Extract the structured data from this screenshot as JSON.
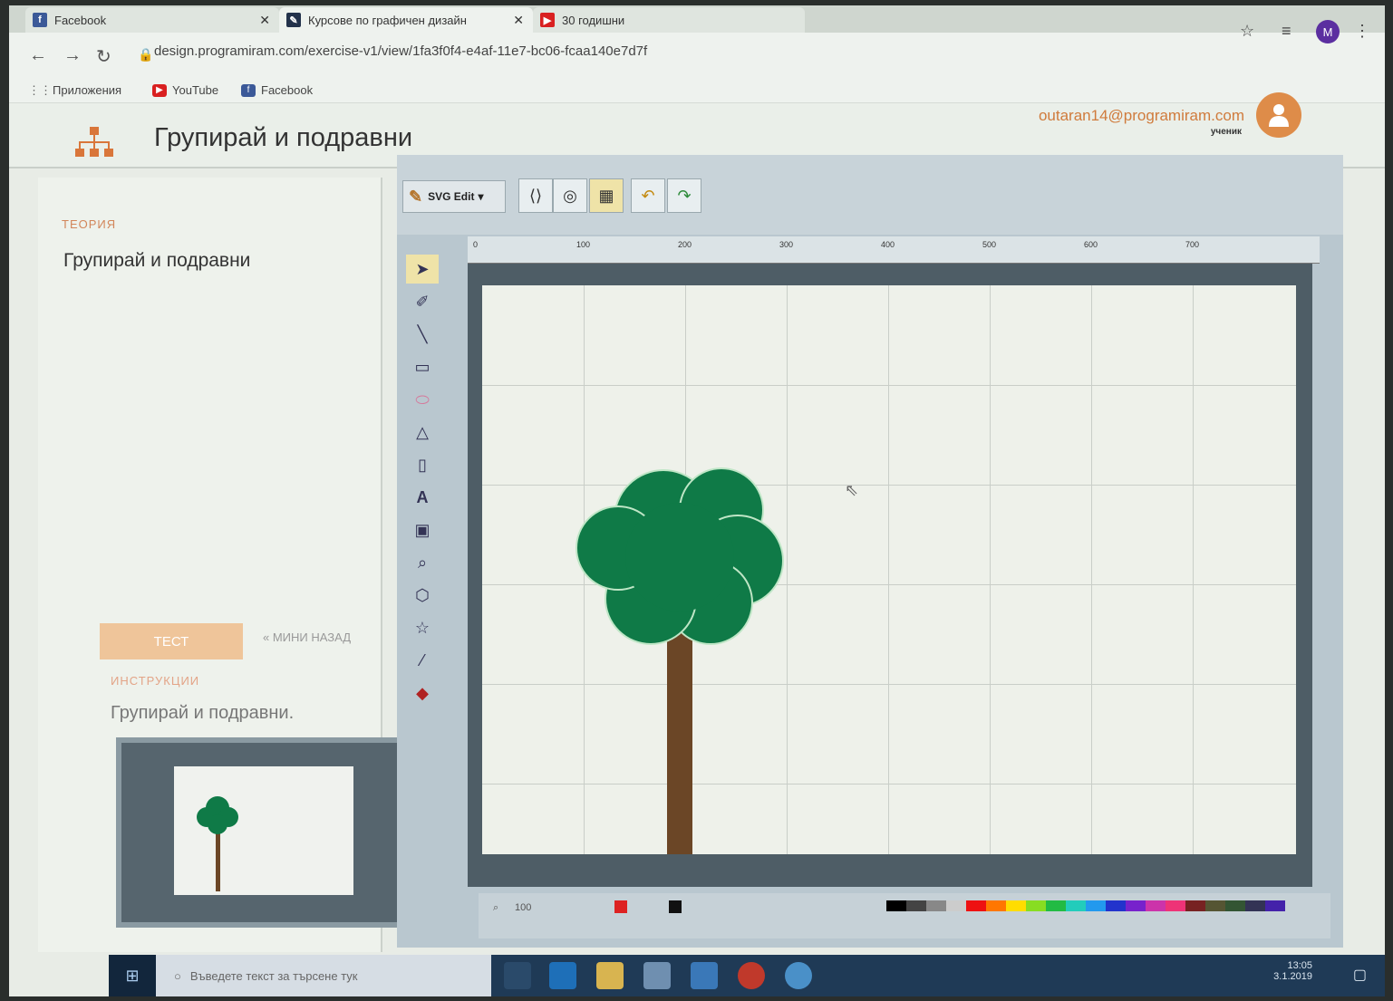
{
  "browser": {
    "tabs": [
      {
        "label": "Facebook",
        "favicon": "facebook-icon"
      },
      {
        "label": "Курсове по графичен дизайн",
        "favicon": "programiram-icon"
      },
      {
        "label": "30 годишни",
        "favicon": "youtube-icon"
      }
    ],
    "url": "design.programiram.com/exercise-v1/view/1fa3f0f4-e4af-11e7-bc06-fcaa140e7d7f",
    "profile_initial": "M",
    "bookmarks": [
      {
        "label": "Приложения",
        "icon": "apps-icon"
      },
      {
        "label": "YouTube",
        "icon": "youtube-icon"
      },
      {
        "label": "Facebook",
        "icon": "facebook-icon"
      }
    ]
  },
  "header": {
    "title": "Групирай и подравни",
    "user_email": "outaran14@programiram.com",
    "user_role": "ученик",
    "accent": "#d07b3c"
  },
  "left_panel": {
    "theory_label": "ТЕОРИЯ",
    "theory_title": "Групирай и подравни",
    "test_button": "ТЕСТ",
    "back_link": "« МИНИ НАЗАД",
    "instructions_label": "ИНСТРУКЦИИ",
    "instructions_text": "Групирай и подравни."
  },
  "editor": {
    "menu_label": "SVG Edit",
    "ruler_ticks": [
      "0",
      "100",
      "200",
      "300",
      "400",
      "500",
      "600",
      "700"
    ],
    "zoom": "100",
    "tree_color": "#0f7a47",
    "trunk_color": "#6b4626"
  },
  "taskbar": {
    "search_placeholder": "Въведете текст за търсене тук",
    "time": "13:05",
    "date": "3.1.2019"
  }
}
